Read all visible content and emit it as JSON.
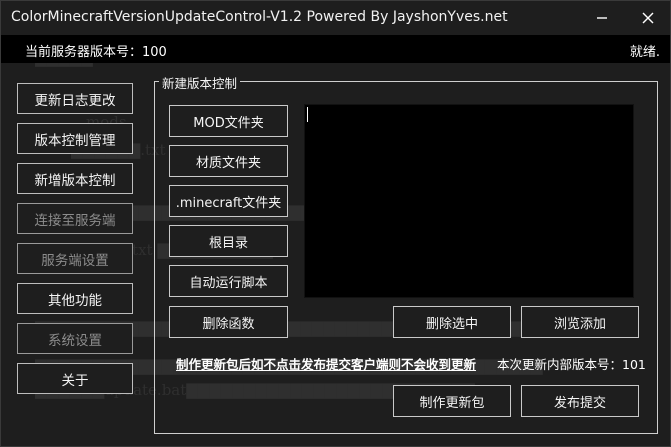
{
  "window": {
    "title": "ColorMinecraftVersionUpdateControl-V1.2 Powered By JayshonYves.net"
  },
  "status": {
    "server_version": "当前服务器版本号：100",
    "state": "就绪."
  },
  "nav": {
    "changelog": "更新日志更改",
    "version_control": "版本控制管理",
    "new_version": "新增版本控制",
    "connect_server": "连接至服务端",
    "server_settings": "服务端设置",
    "other_functions": "其他功能",
    "system_settings": "系统设置",
    "about": "关于"
  },
  "group": {
    "title": "新建版本控制"
  },
  "folders": {
    "mod": "MOD文件夹",
    "material": "材质文件夹",
    "minecraft": ".minecraft文件夹",
    "root": "根目录",
    "autorun": "自动运行脚本",
    "delete_function": "删除函数"
  },
  "actions": {
    "delete_selected": "删除选中",
    "browse_add": "浏览添加",
    "make_package": "制作更新包",
    "publish": "发布提交"
  },
  "notice": {
    "warning": "制作更新包后如不点击发布提交客户端则不会收到更新",
    "internal_version": "本次更新内部版本号：101"
  },
  "textarea": {
    "value": ""
  },
  "colors": {
    "background": "#1e1e1e",
    "statusbar": "#000000",
    "border": "#c9c9c9",
    "text": "#ffffff",
    "disabled_text": "#8c8c8c"
  }
}
